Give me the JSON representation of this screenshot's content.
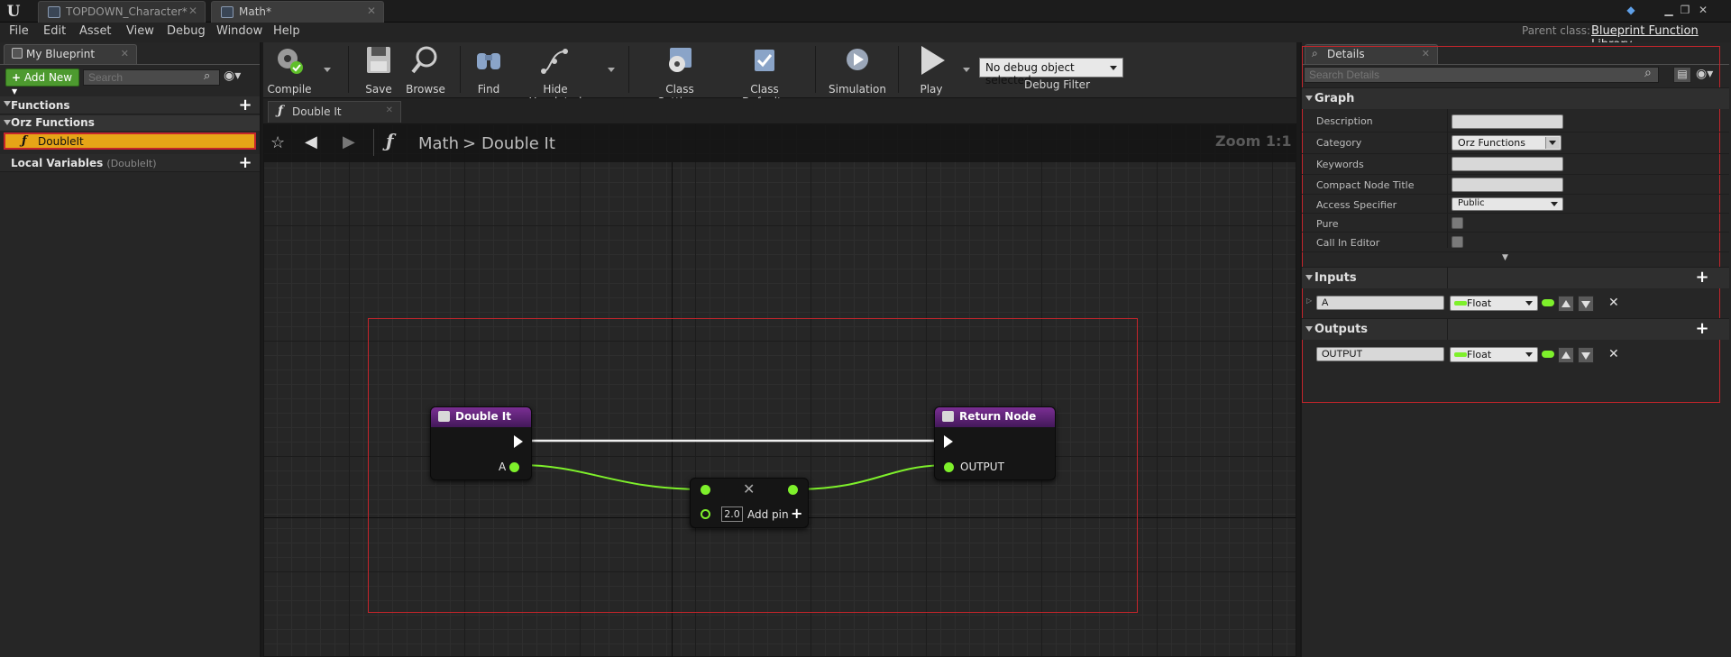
{
  "titlebar": {
    "logo": "U",
    "tabs": [
      {
        "label": "TOPDOWN_Character*"
      },
      {
        "label": "Math*"
      }
    ]
  },
  "menubar": {
    "items": [
      "File",
      "Edit",
      "Asset",
      "View",
      "Debug",
      "Window",
      "Help"
    ],
    "parent_class_label": "Parent class:",
    "parent_class_value": "Blueprint Function Library"
  },
  "my_blueprint": {
    "tab_label": "My Blueprint",
    "add_new_label": "Add New",
    "search_placeholder": "Search",
    "functions_header": "Functions",
    "category_label": "Orz Functions",
    "function_item": "DoubleIt",
    "local_vars_label": "Local Variables",
    "local_vars_scope": "(DoubleIt)"
  },
  "toolbar": {
    "compile": "Compile",
    "save": "Save",
    "browse": "Browse",
    "find": "Find",
    "hide_unrelated": "Hide Unrelated",
    "class_settings": "Class Settings",
    "class_defaults": "Class Defaults",
    "simulation": "Simulation",
    "play": "Play",
    "debug_select": "No debug object selected",
    "debug_filter": "Debug Filter"
  },
  "graph": {
    "tab_label": "Double It",
    "breadcrumb_root": "Math",
    "breadcrumb_separator": ">",
    "breadcrumb_current": "Double It",
    "zoom": "Zoom 1:1",
    "entry_node": {
      "title": "Double It",
      "input_pin": "A"
    },
    "return_node": {
      "title": "Return Node",
      "output_pin": "OUTPUT"
    },
    "multiply_node": {
      "constant": "2.0",
      "add_pin_label": "Add pin"
    }
  },
  "details": {
    "tab_label": "Details",
    "search_placeholder": "Search Details",
    "graph_section": "Graph",
    "rows": {
      "description_label": "Description",
      "description_value": "",
      "category_label": "Category",
      "category_value": "Orz Functions",
      "keywords_label": "Keywords",
      "keywords_value": "",
      "compact_label": "Compact Node Title",
      "compact_value": "",
      "access_label": "Access Specifier",
      "access_value": "Public",
      "pure_label": "Pure",
      "call_in_editor_label": "Call In Editor"
    },
    "inputs_section": "Inputs",
    "input_param": {
      "name": "A",
      "type": "Float"
    },
    "outputs_section": "Outputs",
    "output_param": {
      "name": "OUTPUT",
      "type": "Float"
    }
  },
  "colors": {
    "float_pin": "#7ef02b",
    "function_header": "#5c2273",
    "selection_red": "#c4252b",
    "selected_item": "#e6a517",
    "add_new_green": "#4d9a2f"
  }
}
